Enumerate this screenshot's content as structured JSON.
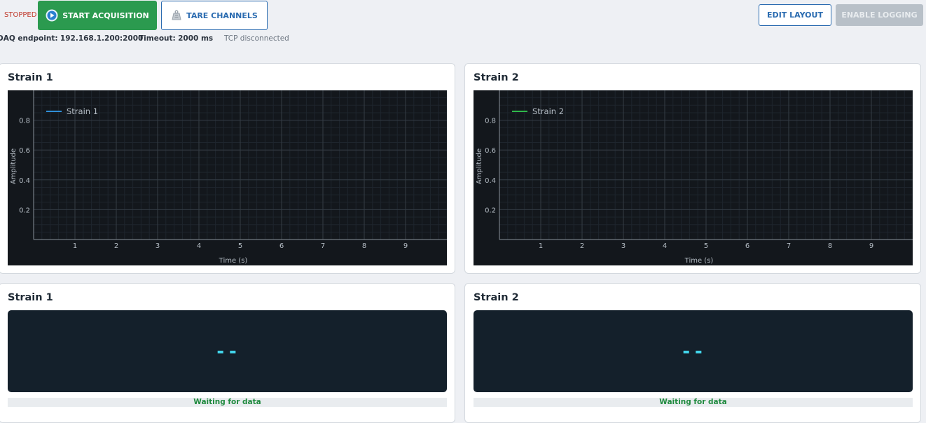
{
  "toolbar": {
    "status": "STOPPED",
    "start_label": "START ACQUISITION",
    "tare_label": "TARE CHANNELS",
    "edit_layout_label": "EDIT LAYOUT",
    "enable_logging_label": "ENABLE LOGGING"
  },
  "info": {
    "daq_label": "DAQ endpoint:",
    "daq_value": "192.168.1.200:2000",
    "timeout_label": "Timeout:",
    "timeout_value": "2000 ms",
    "tcp_status": "TCP disconnected"
  },
  "charts": [
    {
      "title": "Strain 1",
      "legend": "Strain 1",
      "color": "#2f8fd8"
    },
    {
      "title": "Strain 2",
      "legend": "Strain 2",
      "color": "#2fb84a"
    }
  ],
  "chart_data": [
    {
      "type": "line",
      "title": "Strain 1",
      "xlabel": "Time (s)",
      "ylabel": "Amplitude",
      "xlim": [
        0,
        10
      ],
      "ylim": [
        0,
        1
      ],
      "x_ticks": [
        "1",
        "2",
        "3",
        "4",
        "5",
        "6",
        "7",
        "8",
        "9"
      ],
      "y_ticks": [
        "0.2",
        "0.4",
        "0.6",
        "0.8"
      ],
      "grid": true,
      "legend_position": "top-left",
      "series": [
        {
          "name": "Strain 1",
          "x": [],
          "y": [],
          "color": "#2f8fd8"
        }
      ]
    },
    {
      "type": "line",
      "title": "Strain 2",
      "xlabel": "Time (s)",
      "ylabel": "Amplitude",
      "xlim": [
        0,
        10
      ],
      "ylim": [
        0,
        1
      ],
      "x_ticks": [
        "1",
        "2",
        "3",
        "4",
        "5",
        "6",
        "7",
        "8",
        "9"
      ],
      "y_ticks": [
        "0.2",
        "0.4",
        "0.6",
        "0.8"
      ],
      "grid": true,
      "legend_position": "top-left",
      "series": [
        {
          "name": "Strain 2",
          "x": [],
          "y": [],
          "color": "#2fb84a"
        }
      ]
    }
  ],
  "readouts": [
    {
      "title": "Strain 1",
      "value": "--",
      "status": "Waiting for data"
    },
    {
      "title": "Strain 2",
      "value": "--",
      "status": "Waiting for data"
    }
  ],
  "colors": {
    "accent": "#2a6bb0",
    "start": "#2b9a4f",
    "status_stopped": "#c0392b",
    "readout_value": "#41d2e8",
    "waiting": "#1f8a3e"
  }
}
